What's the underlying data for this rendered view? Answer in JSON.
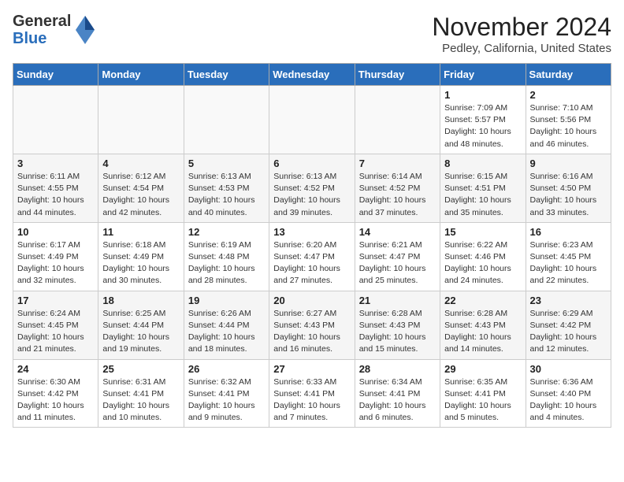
{
  "logo": {
    "general": "General",
    "blue": "Blue"
  },
  "title": "November 2024",
  "location": "Pedley, California, United States",
  "days_of_week": [
    "Sunday",
    "Monday",
    "Tuesday",
    "Wednesday",
    "Thursday",
    "Friday",
    "Saturday"
  ],
  "weeks": [
    [
      {
        "day": "",
        "info": ""
      },
      {
        "day": "",
        "info": ""
      },
      {
        "day": "",
        "info": ""
      },
      {
        "day": "",
        "info": ""
      },
      {
        "day": "",
        "info": ""
      },
      {
        "day": "1",
        "info": "Sunrise: 7:09 AM\nSunset: 5:57 PM\nDaylight: 10 hours\nand 48 minutes."
      },
      {
        "day": "2",
        "info": "Sunrise: 7:10 AM\nSunset: 5:56 PM\nDaylight: 10 hours\nand 46 minutes."
      }
    ],
    [
      {
        "day": "3",
        "info": "Sunrise: 6:11 AM\nSunset: 4:55 PM\nDaylight: 10 hours\nand 44 minutes."
      },
      {
        "day": "4",
        "info": "Sunrise: 6:12 AM\nSunset: 4:54 PM\nDaylight: 10 hours\nand 42 minutes."
      },
      {
        "day": "5",
        "info": "Sunrise: 6:13 AM\nSunset: 4:53 PM\nDaylight: 10 hours\nand 40 minutes."
      },
      {
        "day": "6",
        "info": "Sunrise: 6:13 AM\nSunset: 4:52 PM\nDaylight: 10 hours\nand 39 minutes."
      },
      {
        "day": "7",
        "info": "Sunrise: 6:14 AM\nSunset: 4:52 PM\nDaylight: 10 hours\nand 37 minutes."
      },
      {
        "day": "8",
        "info": "Sunrise: 6:15 AM\nSunset: 4:51 PM\nDaylight: 10 hours\nand 35 minutes."
      },
      {
        "day": "9",
        "info": "Sunrise: 6:16 AM\nSunset: 4:50 PM\nDaylight: 10 hours\nand 33 minutes."
      }
    ],
    [
      {
        "day": "10",
        "info": "Sunrise: 6:17 AM\nSunset: 4:49 PM\nDaylight: 10 hours\nand 32 minutes."
      },
      {
        "day": "11",
        "info": "Sunrise: 6:18 AM\nSunset: 4:49 PM\nDaylight: 10 hours\nand 30 minutes."
      },
      {
        "day": "12",
        "info": "Sunrise: 6:19 AM\nSunset: 4:48 PM\nDaylight: 10 hours\nand 28 minutes."
      },
      {
        "day": "13",
        "info": "Sunrise: 6:20 AM\nSunset: 4:47 PM\nDaylight: 10 hours\nand 27 minutes."
      },
      {
        "day": "14",
        "info": "Sunrise: 6:21 AM\nSunset: 4:47 PM\nDaylight: 10 hours\nand 25 minutes."
      },
      {
        "day": "15",
        "info": "Sunrise: 6:22 AM\nSunset: 4:46 PM\nDaylight: 10 hours\nand 24 minutes."
      },
      {
        "day": "16",
        "info": "Sunrise: 6:23 AM\nSunset: 4:45 PM\nDaylight: 10 hours\nand 22 minutes."
      }
    ],
    [
      {
        "day": "17",
        "info": "Sunrise: 6:24 AM\nSunset: 4:45 PM\nDaylight: 10 hours\nand 21 minutes."
      },
      {
        "day": "18",
        "info": "Sunrise: 6:25 AM\nSunset: 4:44 PM\nDaylight: 10 hours\nand 19 minutes."
      },
      {
        "day": "19",
        "info": "Sunrise: 6:26 AM\nSunset: 4:44 PM\nDaylight: 10 hours\nand 18 minutes."
      },
      {
        "day": "20",
        "info": "Sunrise: 6:27 AM\nSunset: 4:43 PM\nDaylight: 10 hours\nand 16 minutes."
      },
      {
        "day": "21",
        "info": "Sunrise: 6:28 AM\nSunset: 4:43 PM\nDaylight: 10 hours\nand 15 minutes."
      },
      {
        "day": "22",
        "info": "Sunrise: 6:28 AM\nSunset: 4:43 PM\nDaylight: 10 hours\nand 14 minutes."
      },
      {
        "day": "23",
        "info": "Sunrise: 6:29 AM\nSunset: 4:42 PM\nDaylight: 10 hours\nand 12 minutes."
      }
    ],
    [
      {
        "day": "24",
        "info": "Sunrise: 6:30 AM\nSunset: 4:42 PM\nDaylight: 10 hours\nand 11 minutes."
      },
      {
        "day": "25",
        "info": "Sunrise: 6:31 AM\nSunset: 4:41 PM\nDaylight: 10 hours\nand 10 minutes."
      },
      {
        "day": "26",
        "info": "Sunrise: 6:32 AM\nSunset: 4:41 PM\nDaylight: 10 hours\nand 9 minutes."
      },
      {
        "day": "27",
        "info": "Sunrise: 6:33 AM\nSunset: 4:41 PM\nDaylight: 10 hours\nand 7 minutes."
      },
      {
        "day": "28",
        "info": "Sunrise: 6:34 AM\nSunset: 4:41 PM\nDaylight: 10 hours\nand 6 minutes."
      },
      {
        "day": "29",
        "info": "Sunrise: 6:35 AM\nSunset: 4:41 PM\nDaylight: 10 hours\nand 5 minutes."
      },
      {
        "day": "30",
        "info": "Sunrise: 6:36 AM\nSunset: 4:40 PM\nDaylight: 10 hours\nand 4 minutes."
      }
    ]
  ]
}
